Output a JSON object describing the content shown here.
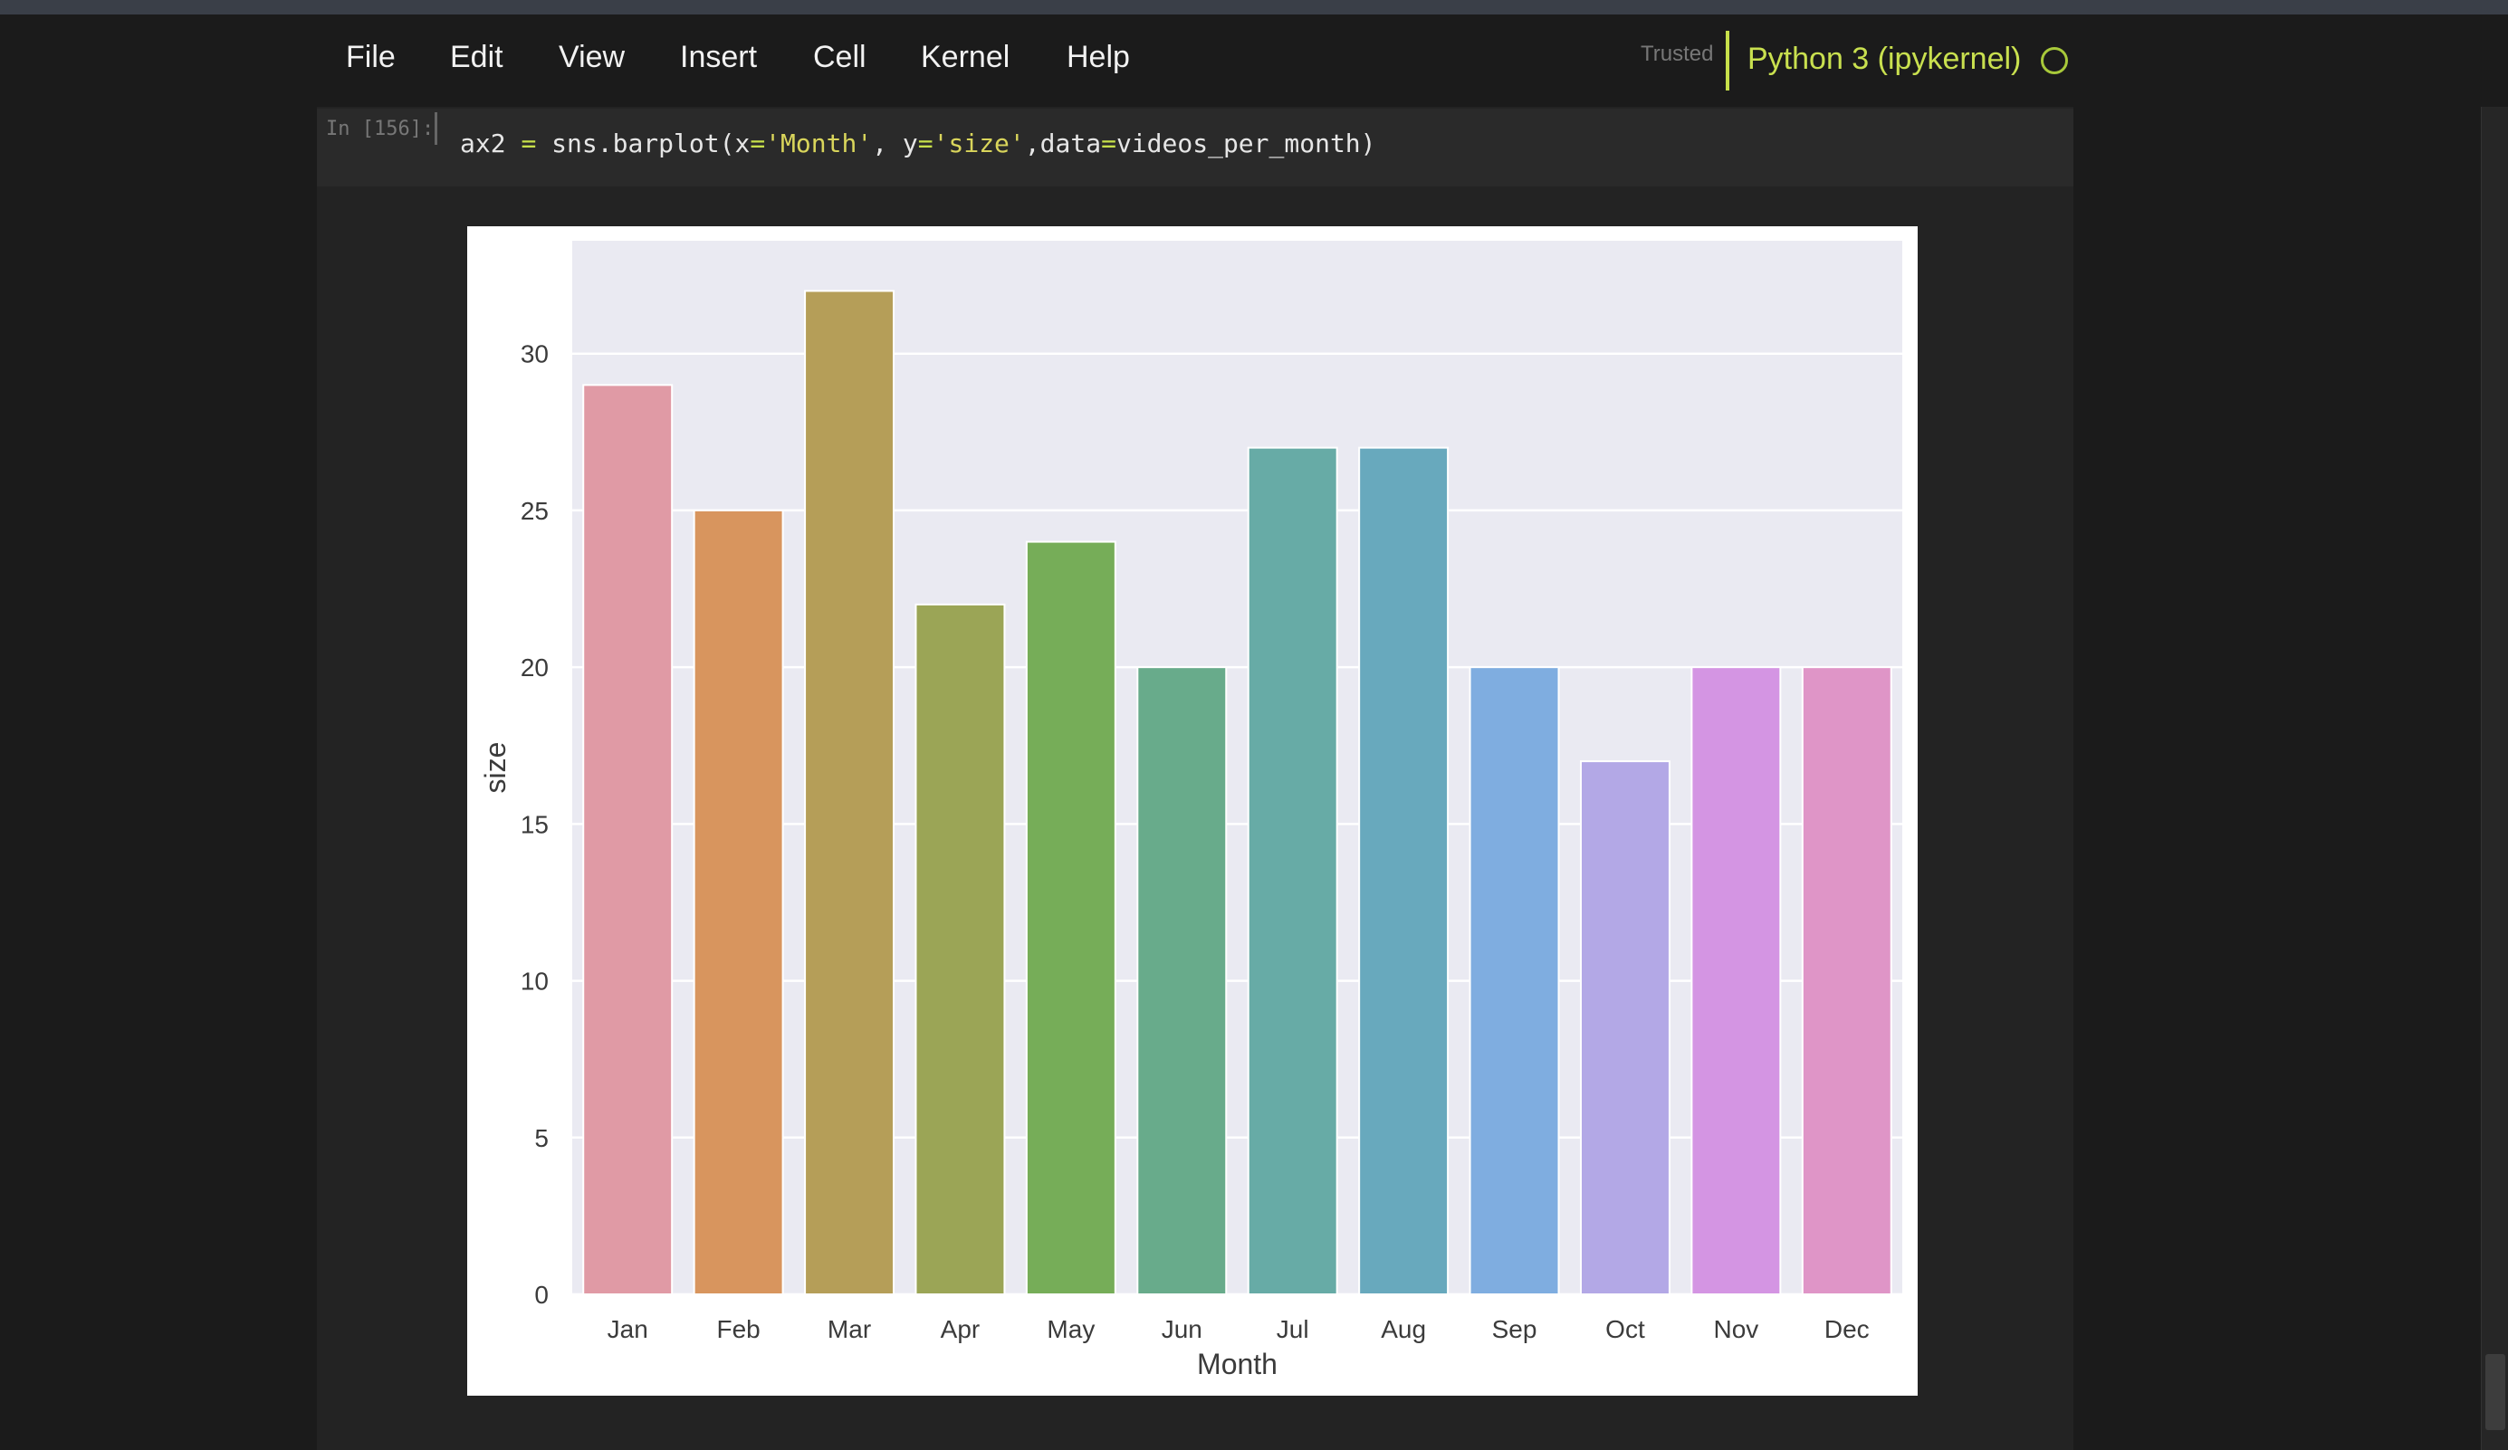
{
  "menu": {
    "items": [
      "File",
      "Edit",
      "View",
      "Insert",
      "Cell",
      "Kernel",
      "Help"
    ],
    "trusted": "Trusted",
    "kernel": "Python 3 (ipykernel)"
  },
  "cell": {
    "prompt": "In [156]:",
    "code_tokens": [
      "ax2 ",
      "=",
      " sns.barplot(x",
      "=",
      "'Month'",
      ", y",
      "=",
      "'size'",
      ",data",
      "=",
      "videos_per_month)"
    ]
  },
  "chart_data": {
    "type": "bar",
    "categories": [
      "Jan",
      "Feb",
      "Mar",
      "Apr",
      "May",
      "Jun",
      "Jul",
      "Aug",
      "Sep",
      "Oct",
      "Nov",
      "Dec"
    ],
    "values": [
      29,
      25,
      32,
      22,
      24,
      20,
      27,
      27,
      20,
      17,
      20,
      20
    ],
    "colors": [
      "#e09aa5",
      "#d8955e",
      "#b59e58",
      "#9ba556",
      "#76ad58",
      "#68ab8b",
      "#67aba6",
      "#68a9bd",
      "#7fade0",
      "#b3a8e6",
      "#d495e3",
      "#df95c7"
    ],
    "xlabel": "Month",
    "ylabel": "size",
    "yticks": [
      0,
      5,
      10,
      15,
      20,
      25,
      30
    ],
    "ylim": [
      0,
      33.6
    ],
    "grid": true
  }
}
